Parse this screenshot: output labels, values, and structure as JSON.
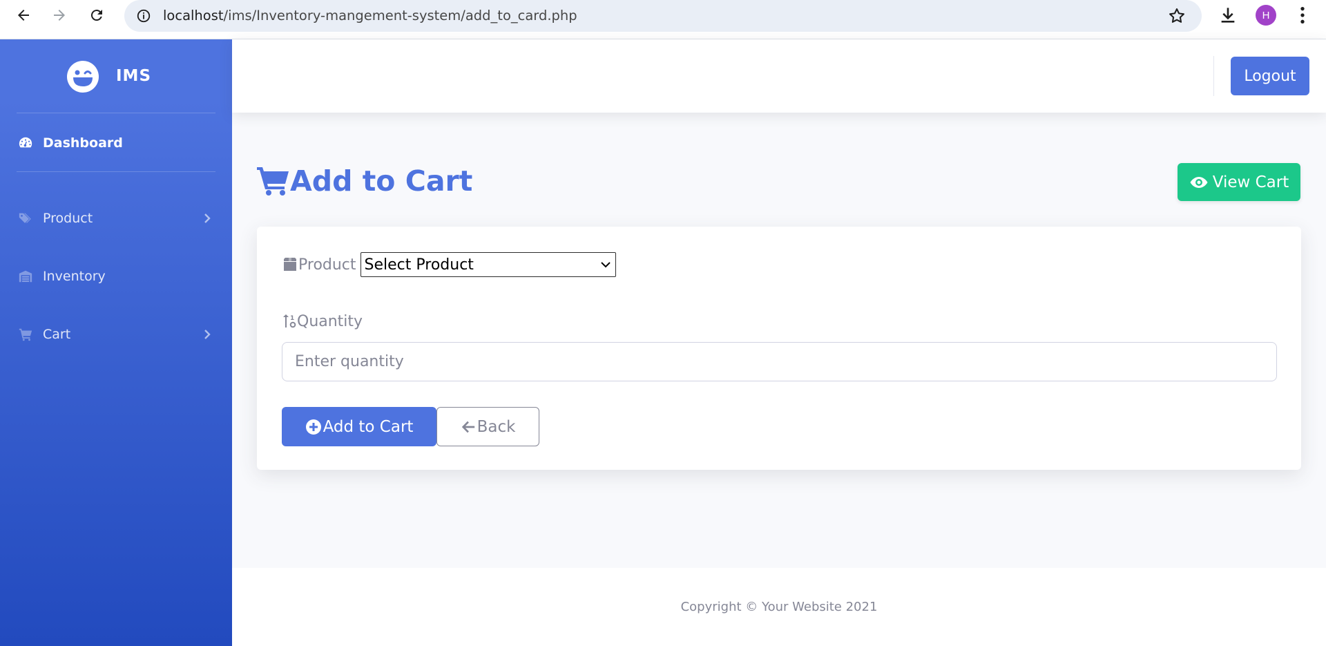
{
  "browser": {
    "url_host": "localhost",
    "url_path": "/ims/Inventory-mangement-system/add_to_card.php",
    "profile_initial": "H"
  },
  "sidebar": {
    "brand": "IMS",
    "items": [
      {
        "label": "Dashboard",
        "icon": "tachometer-icon",
        "active": true
      },
      {
        "label": "Product",
        "icon": "tags-icon",
        "has_submenu": true
      },
      {
        "label": "Inventory",
        "icon": "warehouse-icon"
      },
      {
        "label": "Cart",
        "icon": "shopping-cart-icon",
        "has_submenu": true
      }
    ]
  },
  "topbar": {
    "logout_label": "Logout"
  },
  "main": {
    "title": "Add to Cart",
    "view_cart_label": "View Cart",
    "form": {
      "product_label": "Product",
      "product_selected": "Select Product",
      "quantity_label": "Quantity",
      "quantity_placeholder": "Enter quantity",
      "add_button_label": "Add to Cart",
      "back_button_label": "Back"
    }
  },
  "footer": {
    "copyright": "Copyright © Your Website 2021"
  },
  "colors": {
    "primary": "#4e73df",
    "success": "#1cc88a",
    "secondary": "#858796",
    "sidebar_gradient_end": "#224abe"
  }
}
